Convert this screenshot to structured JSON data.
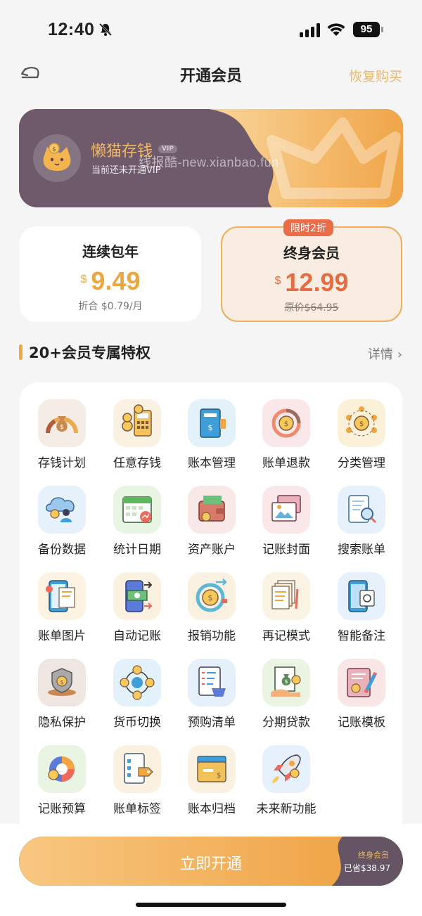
{
  "status_bar": {
    "time": "12:40",
    "battery": "95"
  },
  "nav": {
    "title": "开通会员",
    "restore": "恢复购买"
  },
  "banner": {
    "name": "懒猫存钱",
    "vip": "VIP",
    "subtitle": "当前还未开通VIP",
    "watermark": "线报酷-new.xianbao.fun"
  },
  "plans": {
    "yearly": {
      "title": "连续包年",
      "currency": "$",
      "price": "9.49",
      "note": "折合 $0.79/月"
    },
    "lifetime": {
      "tag": "限时2折",
      "title": "终身会员",
      "currency": "$",
      "price": "12.99",
      "original": "原价$64.95"
    }
  },
  "section": {
    "title": "20+会员专属特权",
    "details": "详情"
  },
  "features": [
    {
      "label": "存钱计划",
      "icon": "money-bag-gauge-icon",
      "bg": "#f6ece6"
    },
    {
      "label": "任意存钱",
      "icon": "calculator-coins-icon",
      "bg": "#fbf1e2"
    },
    {
      "label": "账本管理",
      "icon": "ledger-book-icon",
      "bg": "#e3f1fb"
    },
    {
      "label": "账单退款",
      "icon": "refund-cycle-icon",
      "bg": "#f9e7e9"
    },
    {
      "label": "分类管理",
      "icon": "category-network-icon",
      "bg": "#fbf1d9"
    },
    {
      "label": "备份数据",
      "icon": "cloud-backup-icon",
      "bg": "#e6f1fb"
    },
    {
      "label": "统计日期",
      "icon": "calendar-stats-icon",
      "bg": "#e9f5e3"
    },
    {
      "label": "资产账户",
      "icon": "wallet-icon",
      "bg": "#f9e8e8"
    },
    {
      "label": "记账封面",
      "icon": "cover-photos-icon",
      "bg": "#f9e7ea"
    },
    {
      "label": "搜索账单",
      "icon": "search-bill-icon",
      "bg": "#e6f1fb"
    },
    {
      "label": "账单图片",
      "icon": "phone-receipt-icon",
      "bg": "#fdf3e2"
    },
    {
      "label": "自动记账",
      "icon": "auto-transfer-icon",
      "bg": "#fbf1e0"
    },
    {
      "label": "报销功能",
      "icon": "reimburse-coin-icon",
      "bg": "#fbf1e0"
    },
    {
      "label": "再记模式",
      "icon": "stacked-docs-icon",
      "bg": "#fbf4e4"
    },
    {
      "label": "智能备注",
      "icon": "smart-note-phone-icon",
      "bg": "#e6f1fb"
    },
    {
      "label": "隐私保护",
      "icon": "privacy-shield-icon",
      "bg": "#efe6e2"
    },
    {
      "label": "货币切换",
      "icon": "currency-exchange-icon",
      "bg": "#e3f1fb"
    },
    {
      "label": "预购清单",
      "icon": "shopping-list-icon",
      "bg": "#e6f0fb"
    },
    {
      "label": "分期贷款",
      "icon": "installment-loan-icon",
      "bg": "#ecf4e4"
    },
    {
      "label": "记账模板",
      "icon": "template-pencil-icon",
      "bg": "#f9e6e6"
    },
    {
      "label": "记账预算",
      "icon": "budget-pie-icon",
      "bg": "#eaf4e2"
    },
    {
      "label": "账单标签",
      "icon": "bill-tag-icon",
      "bg": "#fbf1e0"
    },
    {
      "label": "账本归档",
      "icon": "archive-folder-icon",
      "bg": "#fbf1e0"
    },
    {
      "label": "未来新功能",
      "icon": "rocket-icon",
      "bg": "#e6f1fb"
    }
  ],
  "cta": {
    "label": "立即开通",
    "tier": "终身会员",
    "save": "已省$38.97"
  },
  "colors": {
    "accent": "#f0a842",
    "brand_purple": "#6e5a6a",
    "price_red": "#e56d45",
    "price_orange": "#eda73e"
  }
}
